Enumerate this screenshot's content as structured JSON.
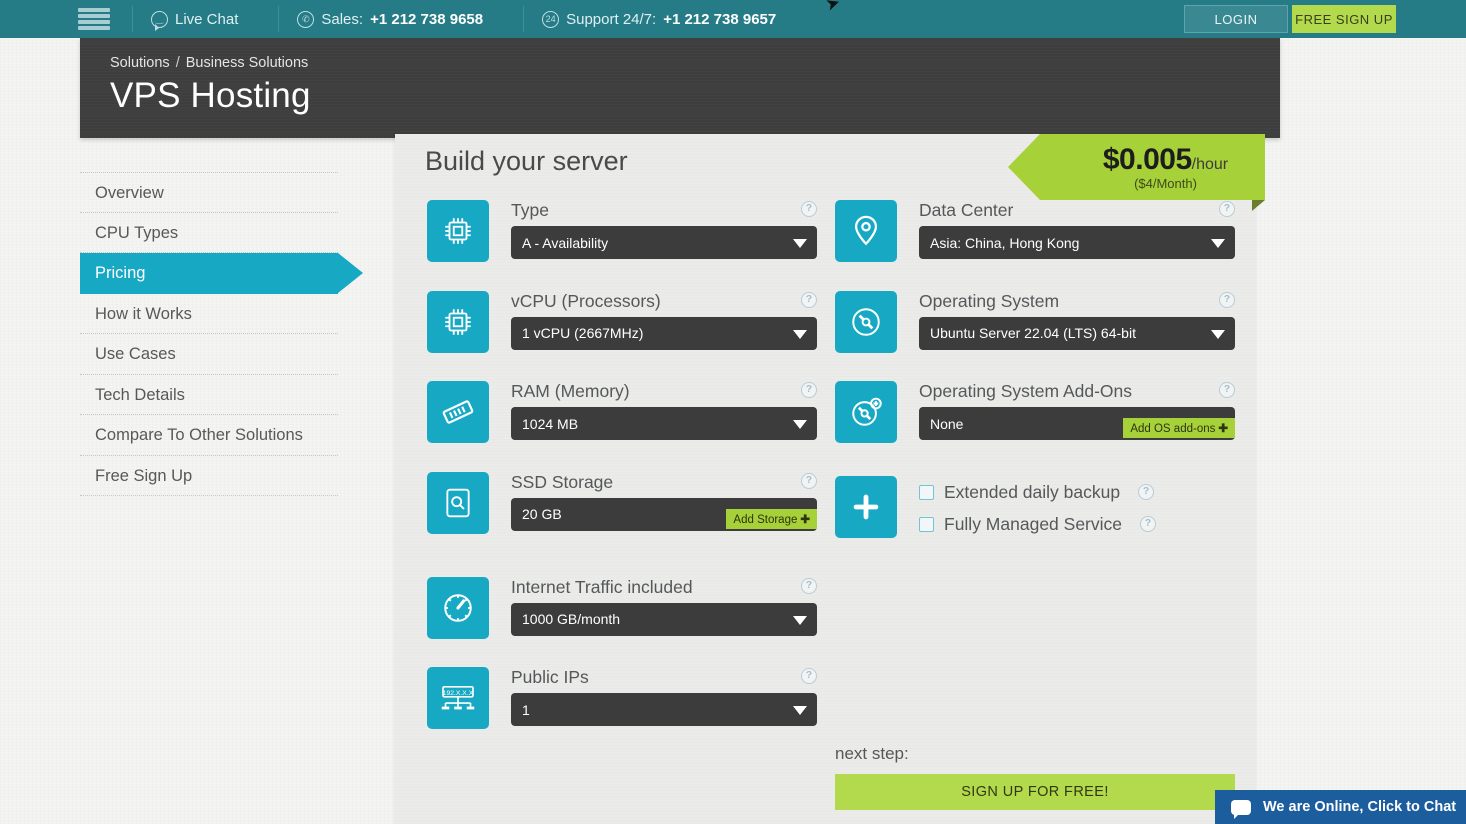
{
  "topbar": {
    "menu_icon": "hamburger-icon",
    "live_chat": {
      "label": "Live Chat",
      "icon": "chat-icon"
    },
    "sales": {
      "label": "Sales:",
      "number": "+1 212 738 9658",
      "icon": "phone-icon"
    },
    "support": {
      "label": "Support 24/7:",
      "number": "+1 212 738 9657",
      "icon": "support-24-icon"
    },
    "login_label": "LOGIN",
    "signup_label": "FREE SIGN UP"
  },
  "header": {
    "breadcrumb_root": "Solutions",
    "breadcrumb_sep": "/",
    "breadcrumb_current": "Business Solutions",
    "title": "VPS Hosting"
  },
  "sidebar": {
    "items": [
      {
        "label": "Overview",
        "active": false
      },
      {
        "label": "CPU Types",
        "active": false
      },
      {
        "label": "Pricing",
        "active": true
      },
      {
        "label": "How it Works",
        "active": false
      },
      {
        "label": "Use Cases",
        "active": false
      },
      {
        "label": "Tech Details",
        "active": false
      },
      {
        "label": "Compare To Other Solutions",
        "active": false
      },
      {
        "label": "Free Sign Up",
        "active": false
      }
    ]
  },
  "panel": {
    "title": "Build your server",
    "price": {
      "amount": "$0.005",
      "unit": "/hour",
      "sub": "($4/Month)"
    }
  },
  "fields_left": [
    {
      "label": "Type",
      "icon": "cpu-chip-icon",
      "value": "A - Availability",
      "help": "?",
      "addon": null
    },
    {
      "label": "vCPU (Processors)",
      "icon": "cpu-chip-icon",
      "value": "1 vCPU (2667MHz)",
      "help": "?",
      "addon": null
    },
    {
      "label": "RAM (Memory)",
      "icon": "memory-stick-icon",
      "value": "1024 MB",
      "help": "?",
      "addon": null
    },
    {
      "label": "SSD Storage",
      "icon": "hard-drive-icon",
      "value": "20 GB",
      "help": "?",
      "addon": "Add Storage"
    },
    {
      "label": "Internet Traffic included",
      "icon": "speedometer-icon",
      "value": "1000 GB/month",
      "help": "?",
      "addon": null
    },
    {
      "label": "Public IPs",
      "icon": "ip-network-icon",
      "value": "1",
      "help": "?",
      "addon": null
    }
  ],
  "fields_right": [
    {
      "label": "Data Center",
      "icon": "map-pin-icon",
      "value": "Asia: China, Hong Kong",
      "help": "?",
      "addon": null
    },
    {
      "label": "Operating System",
      "icon": "disc-icon",
      "value": "Ubuntu Server 22.04 (LTS) 64-bit",
      "help": "?",
      "addon": null
    },
    {
      "label": "Operating System Add-Ons",
      "icon": "disc-plus-icon",
      "value": "None",
      "help": "?",
      "addon": "Add OS add-ons"
    }
  ],
  "options": {
    "icon": "plus-icon",
    "items": [
      {
        "label": "Extended daily backup",
        "checked": false,
        "help": "?"
      },
      {
        "label": "Fully Managed Service",
        "checked": false,
        "help": "?"
      }
    ]
  },
  "next_step": {
    "label": "next step:",
    "button": "SIGN UP FOR FREE!"
  },
  "chat_widget": {
    "text": "We are Online, Click to Chat",
    "icon": "chat-bubble-icon"
  },
  "colors": {
    "teal": "#17a9c4",
    "topbar": "#267c86",
    "green": "#a7d138",
    "dark": "#3c3c3c",
    "chat_blue": "#1c5d9e"
  }
}
